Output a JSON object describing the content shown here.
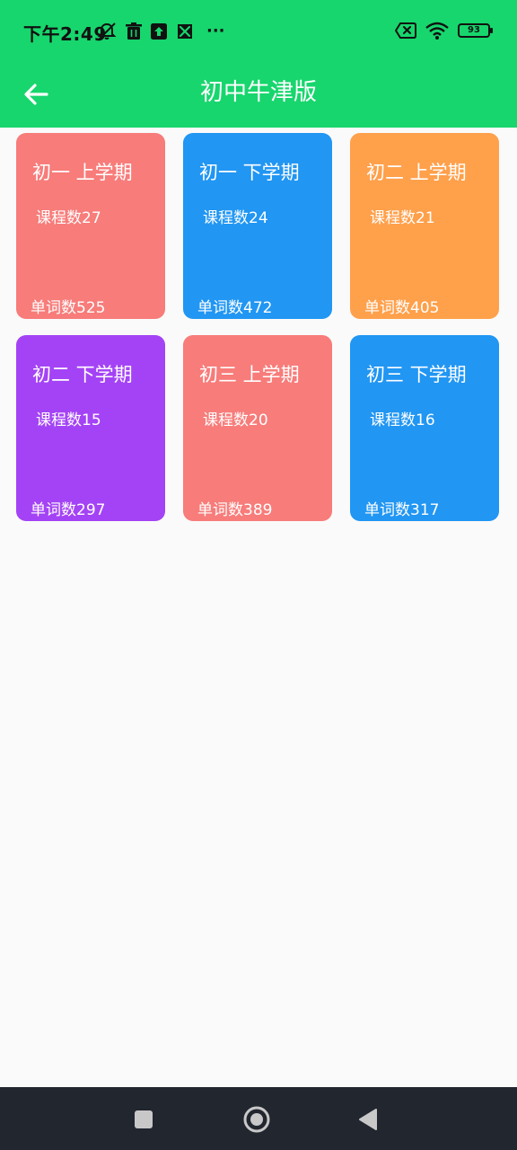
{
  "status_bar": {
    "time": "下午2:49",
    "more": "···",
    "battery_level": "93",
    "icons_left": [
      "mute-vibrate-icon",
      "trash-icon",
      "upload-icon",
      "tools-icon"
    ],
    "icons_right": [
      "sim-error-icon",
      "wifi-icon",
      "battery-icon"
    ]
  },
  "app_bar": {
    "title": "初中牛津版",
    "back_icon": "arrow-left-icon"
  },
  "cards": [
    {
      "title": "初一 上学期",
      "lessons": "课程数27",
      "words": "单词数525",
      "color": "#f77c7a"
    },
    {
      "title": "初一 下学期",
      "lessons": "课程数24",
      "words": "单词数472",
      "color": "#2196f3"
    },
    {
      "title": "初二 上学期",
      "lessons": "课程数21",
      "words": "单词数405",
      "color": "#ffa04b"
    },
    {
      "title": "初二 下学期",
      "lessons": "课程数15",
      "words": "单词数297",
      "color": "#a443f5"
    },
    {
      "title": "初三 上学期",
      "lessons": "课程数20",
      "words": "单词数389",
      "color": "#f77c7a"
    },
    {
      "title": "初三 下学期",
      "lessons": "课程数16",
      "words": "单词数317",
      "color": "#2196f3"
    }
  ],
  "nav_bar": {
    "buttons": [
      "recents-square-icon",
      "home-circle-icon",
      "back-triangle-icon"
    ]
  },
  "colors": {
    "app_bar": "#17d66d",
    "background": "#fafafa",
    "nav_bar": "#21262f"
  }
}
